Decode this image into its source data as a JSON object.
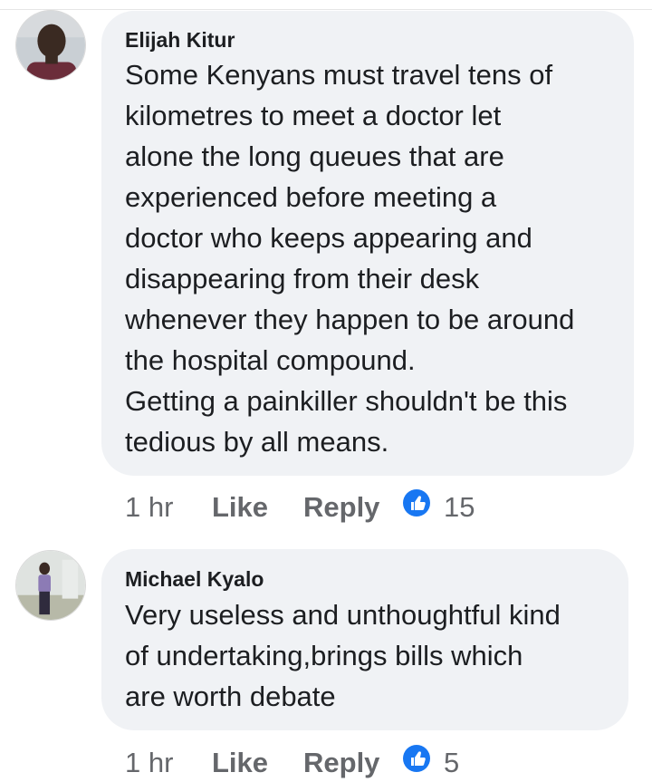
{
  "comments": [
    {
      "author": "Elijah Kitur",
      "lines": [
        "Some Kenyans must travel tens of",
        "kilometres to meet a doctor let",
        "alone the long queues that are",
        "experienced before meeting a",
        "doctor who keeps appearing and",
        "disappearing from their desk",
        "whenever they happen to be around",
        "the hospital compound.",
        "Getting a painkiller shouldn't be this",
        "tedious by all means."
      ],
      "time": "1 hr",
      "like_label": "Like",
      "reply_label": "Reply",
      "reaction_icon": "thumbs-up-icon",
      "reaction_count": "15"
    },
    {
      "author": "Michael Kyalo",
      "lines": [
        "Very useless and unthoughtful kind",
        "of undertaking,brings bills which",
        "are worth debate"
      ],
      "time": "1 hr",
      "like_label": "Like",
      "reply_label": "Reply",
      "reaction_icon": "thumbs-up-icon",
      "reaction_count": "5"
    }
  ],
  "colors": {
    "bubble": "#f0f2f5",
    "text": "#1c1e21",
    "meta": "#65676b",
    "like_blue": "#1877f2"
  }
}
